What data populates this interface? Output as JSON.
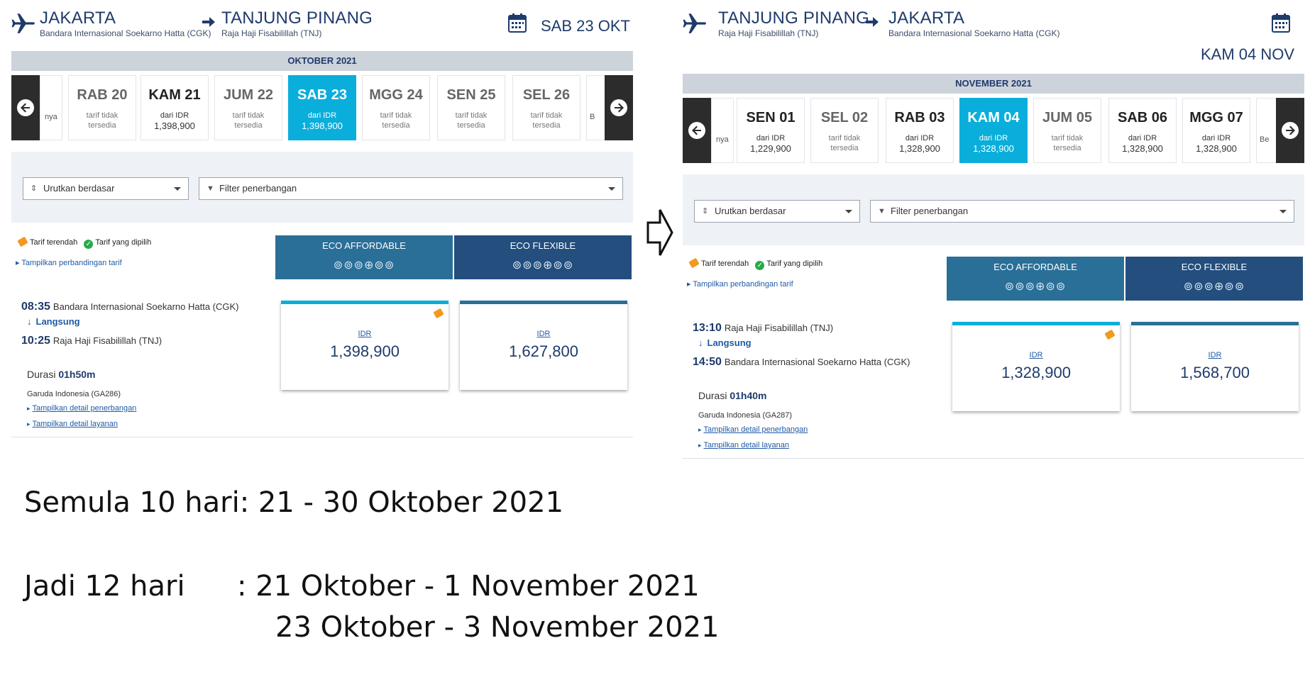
{
  "left": {
    "origin": {
      "city": "JAKARTA",
      "airport": "Bandara Internasional Soekarno Hatta (CGK)"
    },
    "destination": {
      "city": "TANJUNG PINANG",
      "airport": "Raja Haji Fisabilillah (TNJ)"
    },
    "date_label": "SAB 23 OKT",
    "month": "OKTOBER 2021",
    "partial_left": "nya",
    "partial_right": "B",
    "days": [
      {
        "day": "RAB 20",
        "l1": "tarif tidak",
        "l2": "tersedia"
      },
      {
        "day": "KAM 21",
        "l1": "dari IDR",
        "l2": "1,398,900"
      },
      {
        "day": "JUM 22",
        "l1": "tarif tidak",
        "l2": "tersedia"
      },
      {
        "day": "SAB 23",
        "l1": "dari IDR",
        "l2": "1,398,900"
      },
      {
        "day": "MGG 24",
        "l1": "tarif tidak",
        "l2": "tersedia"
      },
      {
        "day": "SEN 25",
        "l1": "tarif tidak",
        "l2": "tersedia"
      },
      {
        "day": "SEL 26",
        "l1": "tarif tidak",
        "l2": "tersedia"
      }
    ],
    "sort_label": "Urutkan berdasar",
    "filter_label": "Filter penerbangan",
    "legend_lowest": "Tarif terendah",
    "legend_selected": "Tarif yang dipilih",
    "compare_link": "Tampilkan perbandingan tarif",
    "fare_affordable": "ECO AFFORDABLE",
    "fare_flexible": "ECO FLEXIBLE",
    "dep_time": "08:35",
    "dep_place": "Bandara Internasional Soekarno Hatta (CGK)",
    "direct": "Langsung",
    "arr_time": "10:25",
    "arr_place": "Raja Haji Fisabilillah (TNJ)",
    "duration_label": "Durasi",
    "duration": "01h50m",
    "carrier": "Garuda Indonesia (GA286)",
    "link_flight": "Tampilkan detail penerbangan",
    "link_service": "Tampilkan detail layanan",
    "currency": "IDR",
    "price_affordable": "1,398,900",
    "price_flexible": "1,627,800"
  },
  "right": {
    "origin": {
      "city": "TANJUNG PINANG",
      "airport": "Raja Haji Fisabilillah (TNJ)"
    },
    "destination": {
      "city": "JAKARTA",
      "airport": "Bandara Internasional Soekarno Hatta (CGK)"
    },
    "date_label": "KAM 04 NOV",
    "month": "NOVEMBER 2021",
    "partial_left": "nya",
    "partial_right": "Be",
    "days": [
      {
        "day": "SEN 01",
        "l1": "dari IDR",
        "l2": "1,229,900"
      },
      {
        "day": "SEL 02",
        "l1": "tarif tidak",
        "l2": "tersedia"
      },
      {
        "day": "RAB 03",
        "l1": "dari IDR",
        "l2": "1,328,900"
      },
      {
        "day": "KAM 04",
        "l1": "dari IDR",
        "l2": "1,328,900"
      },
      {
        "day": "JUM 05",
        "l1": "tarif tidak",
        "l2": "tersedia"
      },
      {
        "day": "SAB 06",
        "l1": "dari IDR",
        "l2": "1,328,900"
      },
      {
        "day": "MGG 07",
        "l1": "dari IDR",
        "l2": "1,328,900"
      }
    ],
    "sort_label": "Urutkan berdasar",
    "filter_label": "Filter penerbangan",
    "legend_lowest": "Tarif terendah",
    "legend_selected": "Tarif yang dipilih",
    "compare_link": "Tampilkan perbandingan tarif",
    "fare_affordable": "ECO AFFORDABLE",
    "fare_flexible": "ECO FLEXIBLE",
    "dep_time": "13:10",
    "dep_place": "Raja Haji Fisabilillah (TNJ)",
    "direct": "Langsung",
    "arr_time": "14:50",
    "arr_place": "Bandara Internasional Soekarno Hatta (CGK)",
    "duration_label": "Durasi",
    "duration": "01h40m",
    "carrier": "Garuda Indonesia (GA287)",
    "link_flight": "Tampilkan detail penerbangan",
    "link_service": "Tampilkan detail layanan",
    "currency": "IDR",
    "price_affordable": "1,328,900",
    "price_flexible": "1,568,700"
  },
  "notes": {
    "line1": "Semula 10 hari: 21 - 30 Oktober 2021",
    "line2_a": "Jadi 12 hari",
    "line2_b": ": 21 Oktober - 1 November 2021",
    "line3": "23 Oktober - 3 November 2021"
  },
  "colors": {
    "selected_day": "#0aaedb",
    "fare_affordable": "#2a6f97",
    "fare_flexible": "#234e7e",
    "brand_text": "#1f3b6b"
  }
}
